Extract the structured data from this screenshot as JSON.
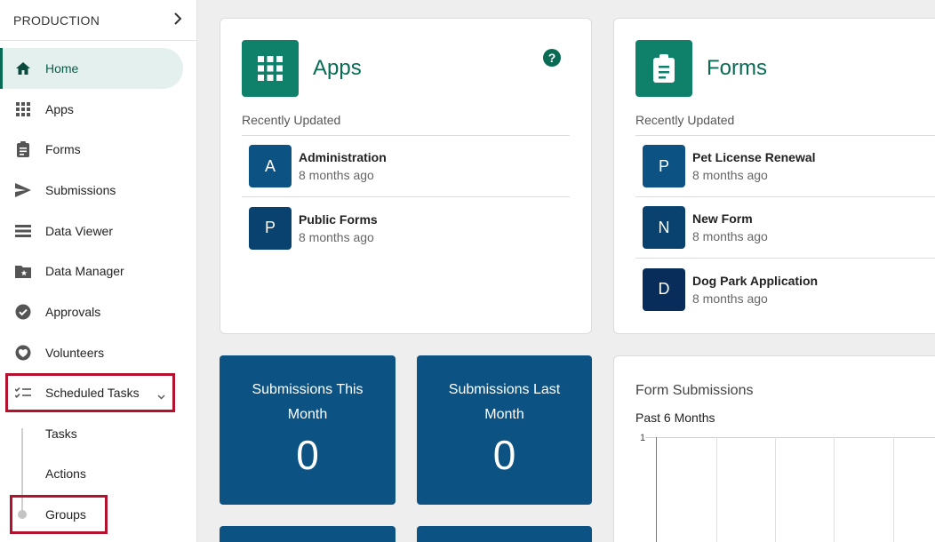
{
  "sidebar": {
    "environment": "PRODUCTION",
    "items": [
      {
        "label": "Home",
        "icon": "home-icon"
      },
      {
        "label": "Apps",
        "icon": "apps-grid-icon"
      },
      {
        "label": "Forms",
        "icon": "clipboard-icon"
      },
      {
        "label": "Submissions",
        "icon": "send-icon"
      },
      {
        "label": "Data Viewer",
        "icon": "list-icon"
      },
      {
        "label": "Data Manager",
        "icon": "folder-star-icon"
      },
      {
        "label": "Approvals",
        "icon": "check-circle-icon"
      },
      {
        "label": "Volunteers",
        "icon": "volunteer-heart-icon"
      },
      {
        "label": "Scheduled Tasks",
        "icon": "checklist-icon"
      }
    ],
    "subitems": [
      {
        "label": "Tasks"
      },
      {
        "label": "Actions"
      },
      {
        "label": "Groups"
      }
    ]
  },
  "apps_card": {
    "title": "Apps",
    "recent_label": "Recently Updated",
    "items": [
      {
        "initial": "A",
        "name": "Administration",
        "updated": "8 months ago",
        "color": "#0c5384"
      },
      {
        "initial": "P",
        "name": "Public Forms",
        "updated": "8 months ago",
        "color": "#0a426f"
      }
    ]
  },
  "forms_card": {
    "title": "Forms",
    "recent_label": "Recently Updated",
    "items": [
      {
        "initial": "P",
        "name": "Pet License Renewal",
        "updated": "8 months ago",
        "color": "#0c5384"
      },
      {
        "initial": "N",
        "name": "New Form",
        "updated": "8 months ago",
        "color": "#0a426f"
      },
      {
        "initial": "D",
        "name": "Dog Park Application",
        "updated": "8 months ago",
        "color": "#082d5a"
      }
    ]
  },
  "stats": [
    {
      "label": "Submissions This Month",
      "value": "0"
    },
    {
      "label": "Submissions Last Month",
      "value": "0"
    }
  ],
  "chart_card": {
    "title": "Form Submissions",
    "subtitle": "Past 6 Months",
    "y_tick": "1"
  },
  "colors": {
    "accent": "#0a6b55",
    "stat_bg": "#0c5384",
    "highlight": "#b3122e"
  }
}
